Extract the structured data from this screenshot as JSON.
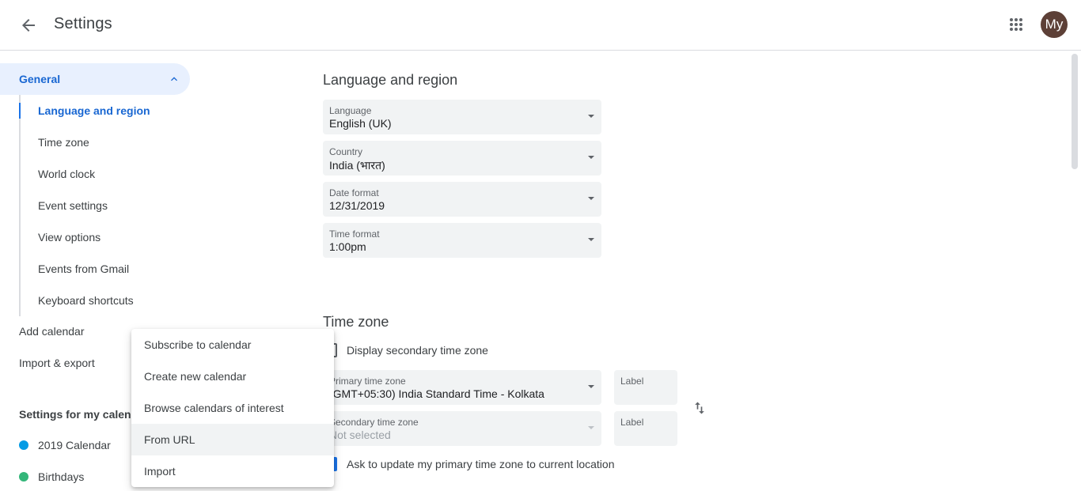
{
  "header": {
    "title": "Settings",
    "avatar_initials": "My"
  },
  "sidebar": {
    "general_label": "General",
    "sub_items": [
      {
        "label": "Language and region"
      },
      {
        "label": "Time zone"
      },
      {
        "label": "World clock"
      },
      {
        "label": "Event settings"
      },
      {
        "label": "View options"
      },
      {
        "label": "Events from Gmail"
      },
      {
        "label": "Keyboard shortcuts"
      }
    ],
    "add_calendar": "Add calendar",
    "import_export": "Import & export",
    "my_calendars_label": "Settings for my calendars",
    "calendars": [
      {
        "label": "2019 Calendar",
        "color": "#039be5"
      },
      {
        "label": "Birthdays",
        "color": "#33b679"
      }
    ]
  },
  "main": {
    "language_region": {
      "title": "Language and region",
      "language": {
        "label": "Language",
        "value": "English (UK)"
      },
      "country": {
        "label": "Country",
        "value": "India (भारत)"
      },
      "date_format": {
        "label": "Date format",
        "value": "12/31/2019"
      },
      "time_format": {
        "label": "Time format",
        "value": "1:00pm"
      }
    },
    "time_zone": {
      "title": "Time zone",
      "display_secondary": "Display secondary time zone",
      "primary": {
        "label": "Primary time zone",
        "value": "(GMT+05:30) India Standard Time - Kolkata",
        "label_placeholder": "Label"
      },
      "secondary": {
        "label": "Secondary time zone",
        "value": "Not selected",
        "label_placeholder": "Label"
      },
      "ask_update": "Ask to update my primary time zone to current location"
    }
  },
  "add_calendar_menu": {
    "items": [
      {
        "label": "Subscribe to calendar"
      },
      {
        "label": "Create new calendar"
      },
      {
        "label": "Browse calendars of interest"
      },
      {
        "label": "From URL"
      },
      {
        "label": "Import"
      }
    ]
  },
  "colors": {
    "accent": "#1a73e8",
    "active_bg": "#e8f0fe",
    "field_bg": "#f1f3f4",
    "avatar_bg": "#5d4037"
  }
}
